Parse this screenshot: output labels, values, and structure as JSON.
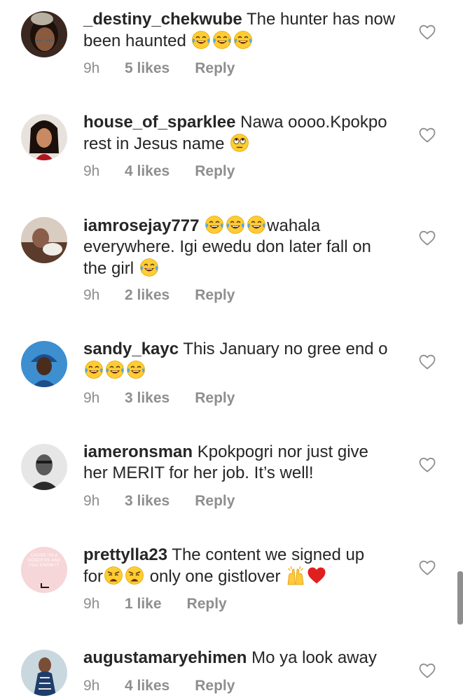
{
  "comments": [
    {
      "username": "_destiny_chekwube",
      "text_a": "The hunter has now",
      "text_b": "been haunted",
      "time": "9h",
      "likes": "5 likes",
      "reply": "Reply"
    },
    {
      "username": "house_of_sparklee",
      "text_a": "Nawa oooo.Kpokpo",
      "text_b": "rest in Jesus name",
      "time": "9h",
      "likes": "4 likes",
      "reply": "Reply"
    },
    {
      "username": "iamrosejay777",
      "text_a": "wahala",
      "text_b": "everywhere. Igi ewedu don later fall on",
      "text_c": "the girl",
      "time": "9h",
      "likes": "2 likes",
      "reply": "Reply"
    },
    {
      "username": "sandy_kayc",
      "text_a": "This January no gree end o",
      "time": "9h",
      "likes": "3 likes",
      "reply": "Reply"
    },
    {
      "username": "iameronsman",
      "text_a": "Kpokpogri nor just give",
      "text_b": "her MERIT for her job. It’s well!",
      "time": "9h",
      "likes": "3 likes",
      "reply": "Reply"
    },
    {
      "username": "prettylla23",
      "text_a": "The content we signed up",
      "text_b": "for",
      "text_c": "only one gistlover",
      "time": "9h",
      "likes": "1 like",
      "reply": "Reply",
      "avatar_text": "CAUSE I'M A GODDESS AND YOU KNOW IT"
    },
    {
      "username": "augustamaryehimen",
      "text_a": "Mo ya look away",
      "time": "9h",
      "likes": "4 likes",
      "reply": "Reply"
    }
  ],
  "icons": {
    "like": "heart-outline-icon",
    "laughing": "face-with-tears-of-joy-emoji",
    "eye_roll": "face-with-rolling-eyes-emoji",
    "weary": "weary-face-emoji",
    "raised_hands": "raising-hands-emoji",
    "red_heart": "red-heart-emoji"
  },
  "colors": {
    "text": "#262626",
    "meta": "#8e8e8e",
    "heart_stroke": "#8e8e8e",
    "red_heart": "#e0201e"
  }
}
